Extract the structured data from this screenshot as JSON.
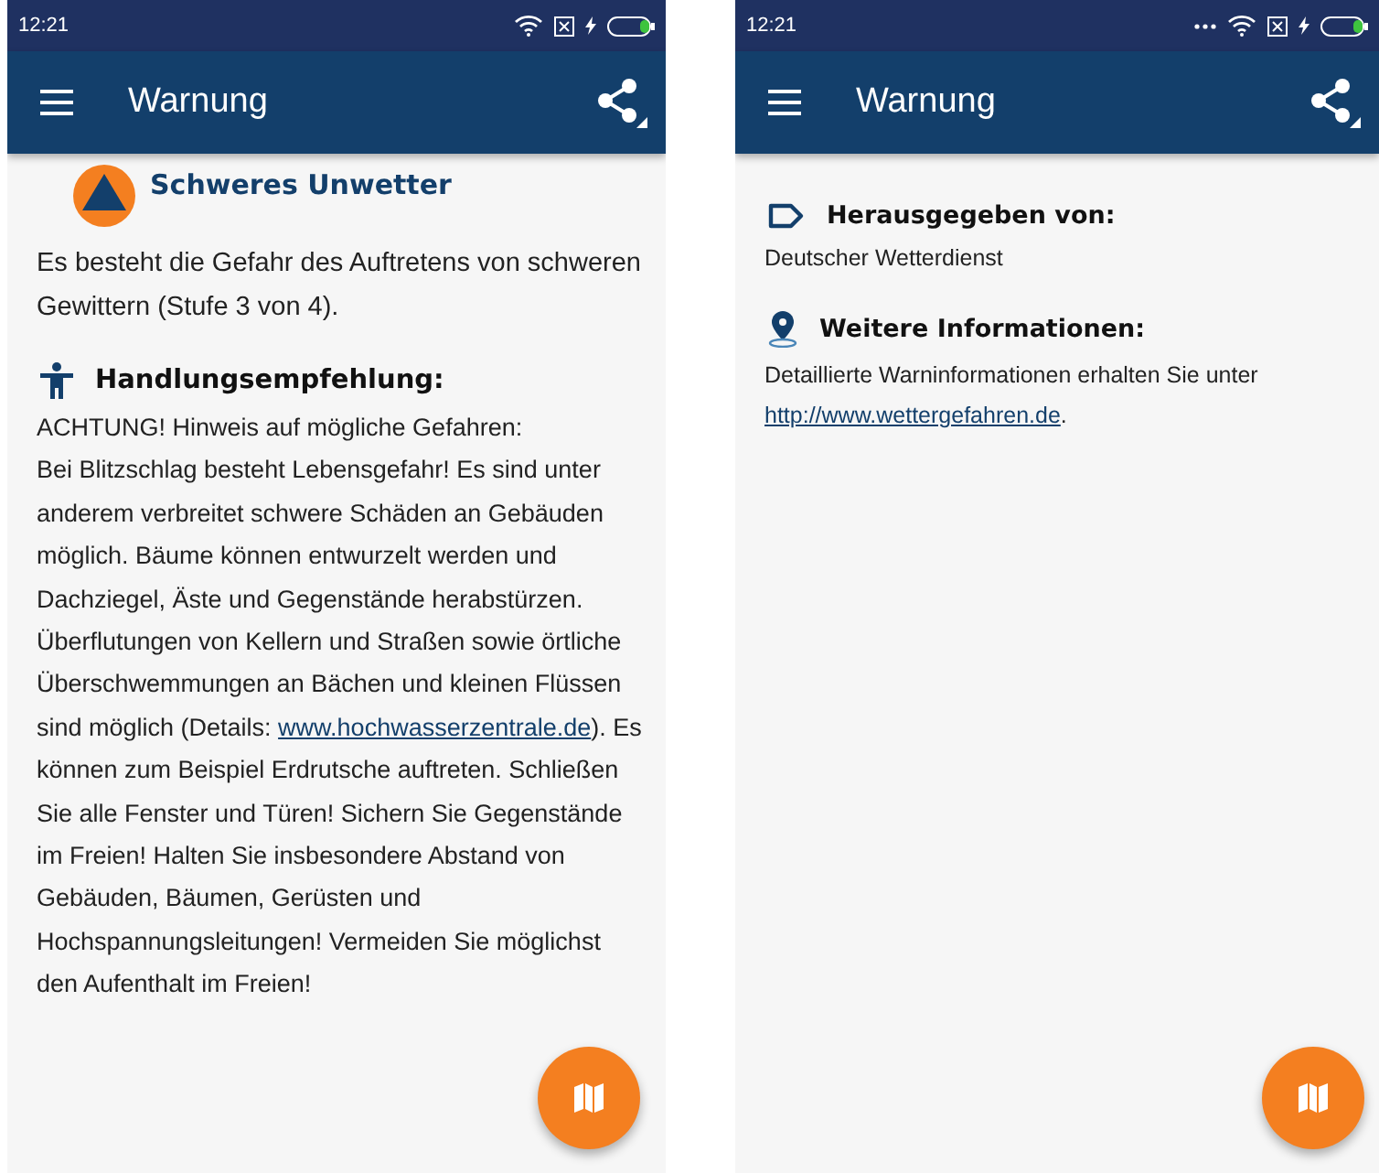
{
  "screens": [
    {
      "status_bar": {
        "time": "12:21",
        "more_indicator": false
      },
      "app_bar": {
        "title": "Warnung"
      },
      "blocks": [
        {
          "kind": "alert",
          "title": "Schweres Unwetter"
        },
        {
          "kind": "lead",
          "parts": [
            {
              "text": "Es besteht die Gefahr des Auftretens von schweren Gewittern (Stufe 3 von 4)."
            }
          ]
        },
        {
          "kind": "advice_heading",
          "title": "Handlungsempfehlung:"
        },
        {
          "kind": "text",
          "parts": [
            {
              "text": "ACHTUNG! Hinweis auf mögliche Gefahren:\nBei Blitzschlag besteht Lebensgefahr! Es sind unter anderem verbreitet schwere Schäden an Gebäuden möglich. Bäume können entwurzelt werden und Dachziegel, Äste und Gegenstände herabstürzen. Überflutungen von Kellern und Straßen sowie örtliche Überschwemmungen an Bächen und kleinen Flüssen sind möglich (Details: "
            },
            {
              "link": "www.hochwasserzentrale.de"
            },
            {
              "text": "). Es können zum Beispiel Erdrutsche auftreten. Schließen Sie alle Fenster und Türen! Sichern Sie Gegenstände im Freien! Halten Sie insbesondere Abstand von Gebäuden, Bäumen, Gerüsten und Hochspannungsleitungen! Vermeiden Sie möglichst den Aufenthalt im Freien!"
            }
          ]
        }
      ]
    },
    {
      "status_bar": {
        "time": "12:21",
        "more_indicator": true
      },
      "app_bar": {
        "title": "Warnung"
      },
      "blocks": [
        {
          "kind": "issuer_heading",
          "title": "Herausgegeben von:"
        },
        {
          "kind": "small",
          "parts": [
            {
              "text": "Deutscher Wetterdienst"
            }
          ]
        },
        {
          "kind": "info_heading",
          "title": "Weitere Informationen:"
        },
        {
          "kind": "small",
          "parts": [
            {
              "text": "Detaillierte Warninformationen erhalten Sie unter "
            },
            {
              "link": "http://www.wettergefahren.de"
            },
            {
              "text": "."
            }
          ]
        }
      ]
    }
  ]
}
